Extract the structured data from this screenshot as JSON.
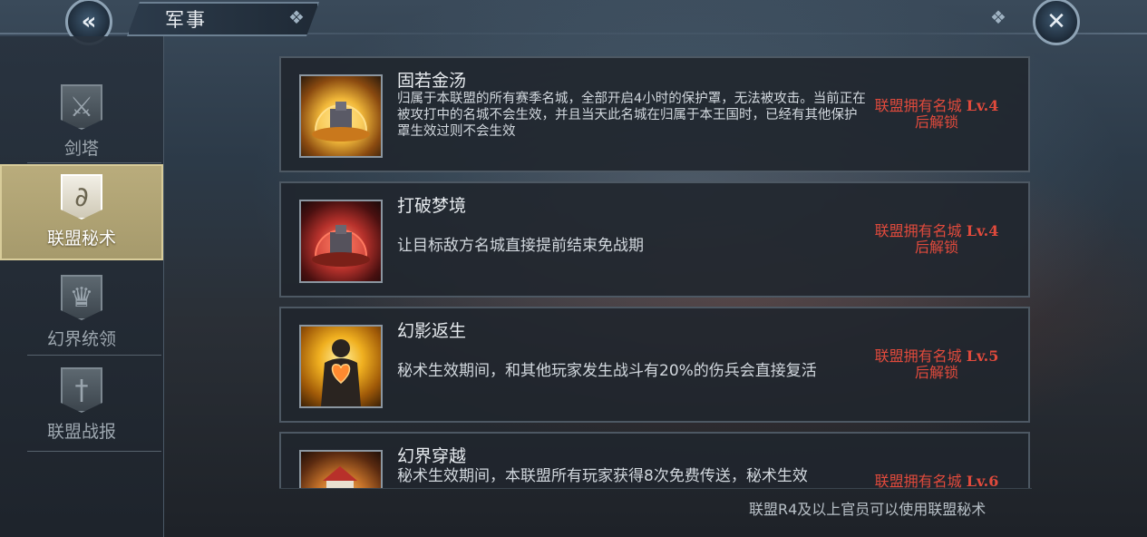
{
  "header": {
    "title": "军事",
    "back_icon": "double-chevron-left-icon",
    "close_icon": "close-icon"
  },
  "sidebar": {
    "items": [
      {
        "label": "剑塔",
        "icon": "crossed-swords-banner-icon",
        "active": false
      },
      {
        "label": "联盟秘术",
        "icon": "rune-banner-icon",
        "active": true
      },
      {
        "label": "幻界统领",
        "icon": "crown-icon",
        "active": false
      },
      {
        "label": "联盟战报",
        "icon": "sword-scroll-icon",
        "active": false
      }
    ]
  },
  "skills": [
    {
      "name": "固若金汤",
      "desc": "归属于本联盟的所有赛季名城，全部开启4小时的保护罩，无法被攻击。当前正在被攻打中的名城不会生效，并且当天此名城在归属于本王国时，已经有其他保护罩生效过则不会生效",
      "lock_prefix": "联盟拥有名城",
      "lock_level": "Lv.4",
      "lock_suffix": "后解锁",
      "thumb_color": "#d99a2a"
    },
    {
      "name": "打破梦境",
      "desc": "让目标敌方名城直接提前结束免战期",
      "lock_prefix": "联盟拥有名城",
      "lock_level": "Lv.4",
      "lock_suffix": "后解锁",
      "thumb_color": "#b8322c"
    },
    {
      "name": "幻影返生",
      "desc": "秘术生效期间，和其他玩家发生战斗有20%的伤兵会直接复活",
      "lock_prefix": "联盟拥有名城",
      "lock_level": "Lv.5",
      "lock_suffix": "后解锁",
      "thumb_color": "#e0a020"
    },
    {
      "name": "幻界穿越",
      "desc": "秘术生效期间，本联盟所有玩家获得8次免费传送，秘术生效",
      "lock_prefix": "联盟拥有名城",
      "lock_level": "Lv.6",
      "lock_suffix": "",
      "thumb_color": "#c8742a"
    }
  ],
  "footer": {
    "note": "联盟R4及以上官员可以使用联盟秘术"
  }
}
